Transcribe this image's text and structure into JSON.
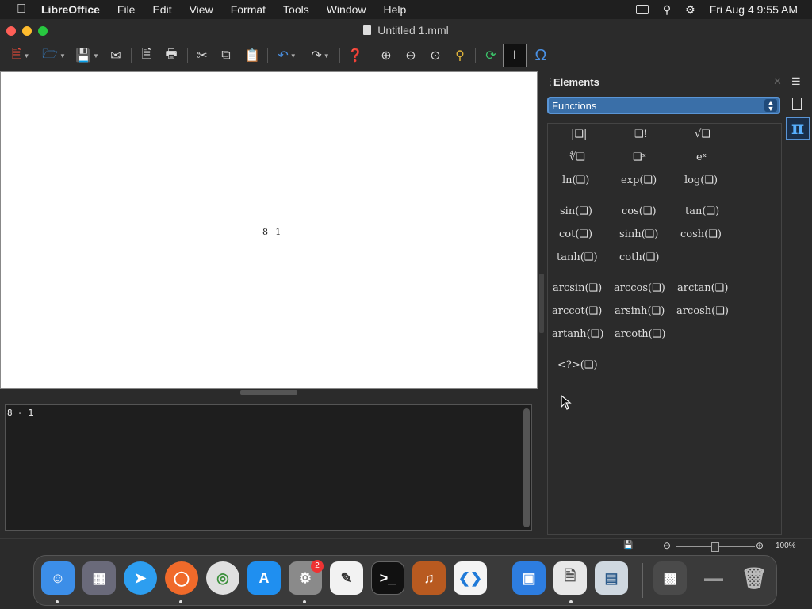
{
  "menubar": {
    "app_name": "LibreOffice",
    "items": [
      "File",
      "Edit",
      "View",
      "Format",
      "Tools",
      "Window",
      "Help"
    ],
    "datetime": "Fri Aug 4  9:55 AM"
  },
  "window": {
    "title": "Untitled 1.mml"
  },
  "toolbar": {
    "icons": [
      "new-document-icon",
      "open-folder-icon",
      "save-icon",
      "email-icon",
      "export-pdf-icon",
      "print-icon",
      "cut-icon",
      "copy-icon",
      "paste-icon",
      "undo-icon",
      "redo-icon",
      "help-icon",
      "zoom-in-icon",
      "zoom-out-icon",
      "zoom-100-icon",
      "show-all-icon",
      "update-icon",
      "formula-cursor-icon",
      "symbols-icon"
    ]
  },
  "preview": {
    "formula": "8−1"
  },
  "editor": {
    "content": "8 - 1"
  },
  "elements_panel": {
    "title": "Elements",
    "category": "Functions",
    "groups": [
      {
        "items": [
          "|❑|",
          "❑!",
          "√❑",
          "∜❑",
          "❑ˣ",
          "eˣ",
          "ln(❑)",
          "exp(❑)",
          "log(❑)"
        ]
      },
      {
        "items": [
          "sin(❑)",
          "cos(❑)",
          "tan(❑)",
          "cot(❑)",
          "sinh(❑)",
          "cosh(❑)",
          "tanh(❑)",
          "coth(❑)"
        ]
      },
      {
        "items": [
          "arcsin(❑)",
          "arccos(❑)",
          "arctan(❑)",
          "arccot(❑)",
          "arsinh(❑)",
          "arcosh(❑)",
          "artanh(❑)",
          "arcoth(❑)"
        ]
      },
      {
        "items": [
          "<?>(❑)"
        ]
      }
    ]
  },
  "statusbar": {
    "zoom": "100%"
  },
  "dock": {
    "apps": [
      "Finder",
      "Launchpad",
      "Safari",
      "Firefox",
      "Chrome",
      "App Store",
      "System Settings",
      "TextEdit",
      "Terminal",
      "GarageBand",
      "VS Code",
      "Keynote",
      "Files",
      "Preview",
      "Screenshots",
      "Trash"
    ],
    "settings_badge": "2"
  },
  "colors": {
    "accent": "#3a6fa8",
    "pi_blue": "#58b0ff",
    "badge": "#e33333"
  }
}
